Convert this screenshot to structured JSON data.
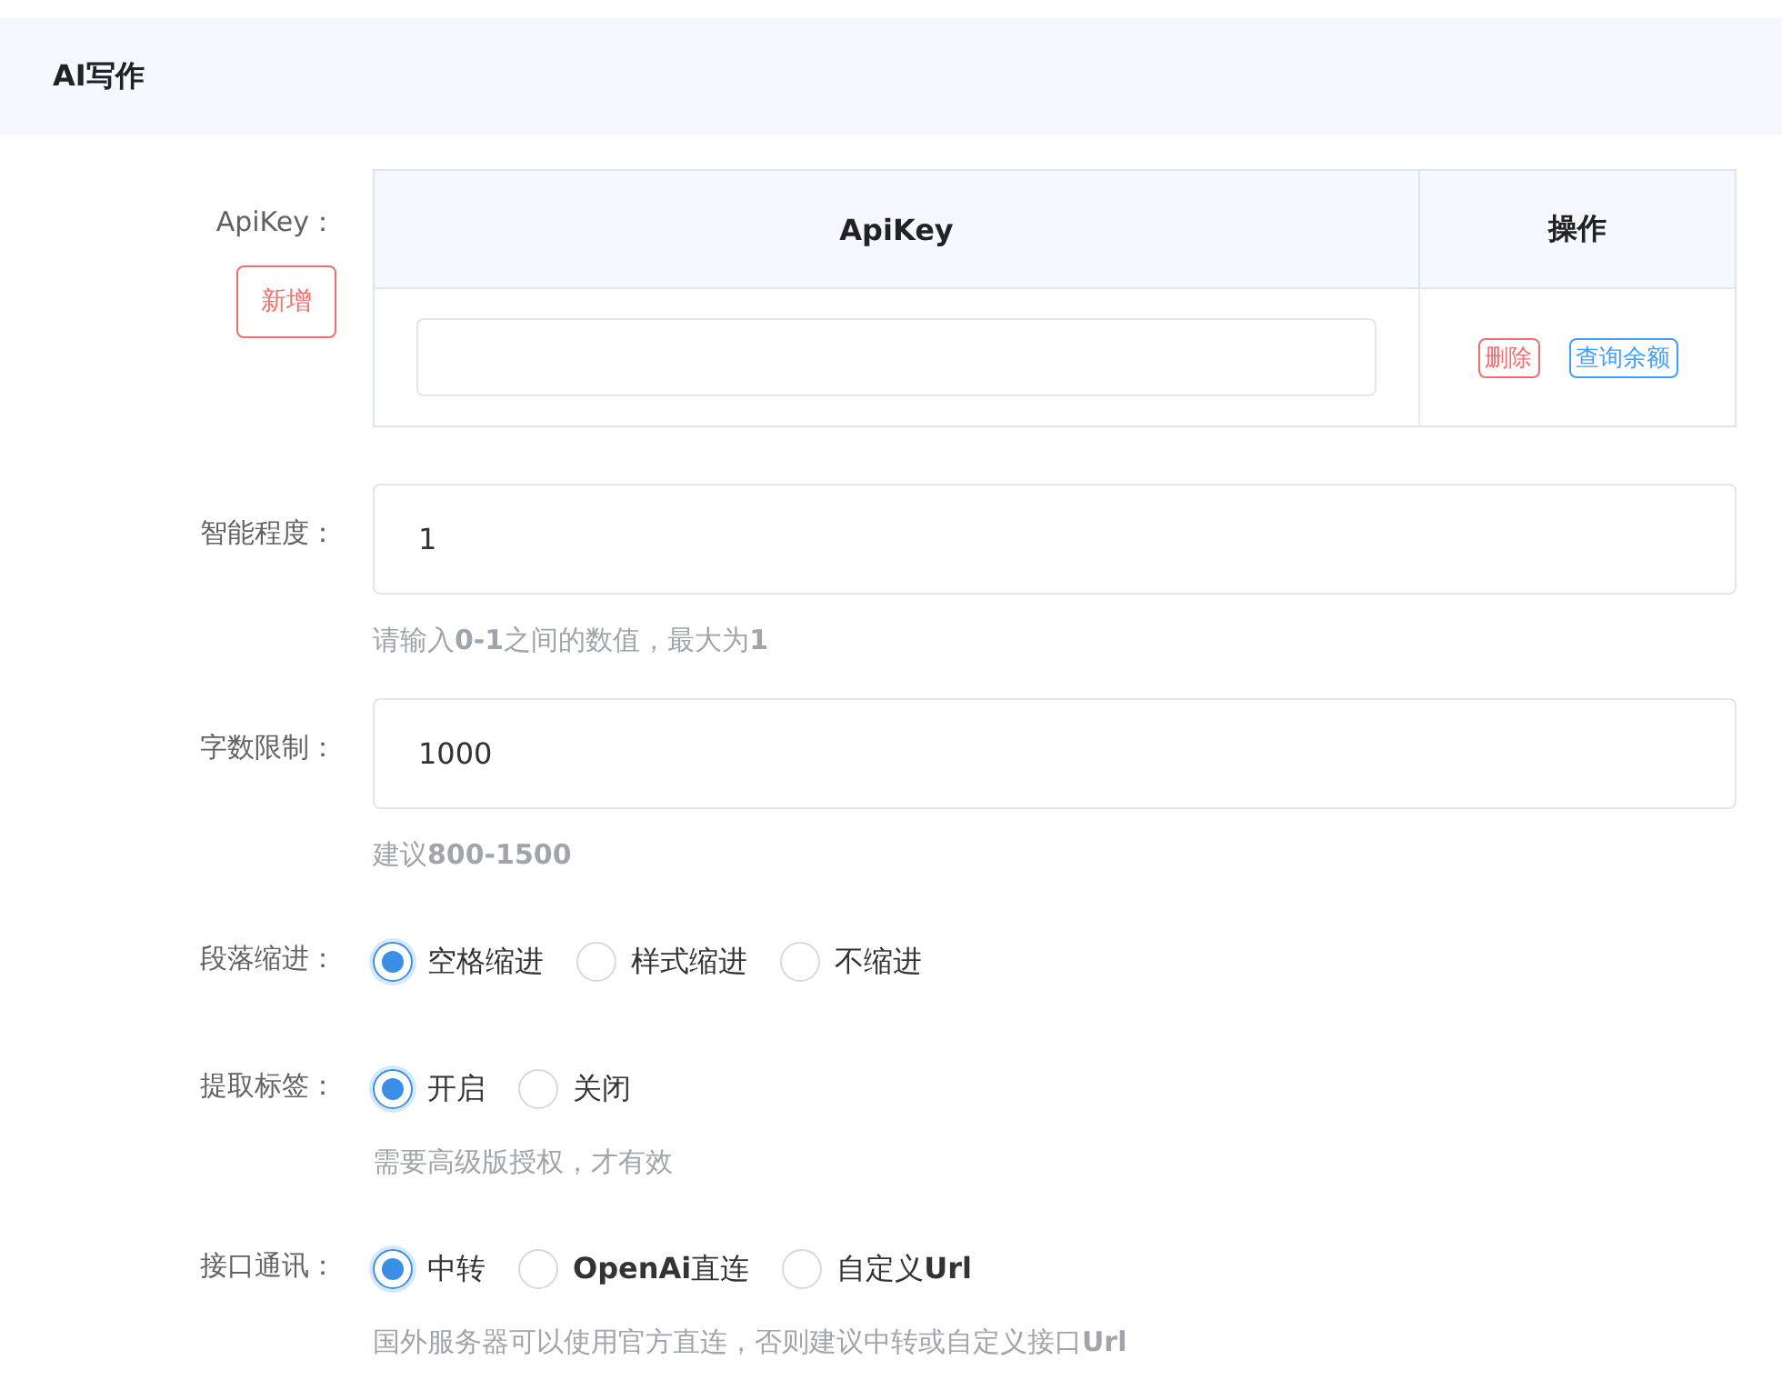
{
  "section": {
    "title": "AI写作"
  },
  "apikey": {
    "label": "ApiKey：",
    "add_button": "新增",
    "columns": [
      "ApiKey",
      "操作"
    ],
    "rows": [
      {
        "actions": [
          {
            "kind": "danger",
            "label": "删除"
          },
          {
            "kind": "primary",
            "label": "查询余额"
          }
        ]
      }
    ]
  },
  "fields": [
    {
      "kind": "input",
      "label": "智能程度：",
      "value": "1",
      "hint": "请输入**0-1**之间的数值，最大为**1**"
    },
    {
      "kind": "input",
      "label": "字数限制：",
      "value": "1000",
      "hint": "建议**800-1500**"
    },
    {
      "kind": "radio",
      "label": "段落缩进：",
      "options": [
        {
          "label": "空格缩进",
          "selected": true
        },
        {
          "label": "样式缩进",
          "selected": false
        },
        {
          "label": "不缩进",
          "selected": false
        }
      ]
    },
    {
      "kind": "radio",
      "label": "提取标签：",
      "options": [
        {
          "label": "开启",
          "selected": true
        },
        {
          "label": "关闭",
          "selected": false
        }
      ],
      "hint": "需要高级版授权，才有效"
    },
    {
      "kind": "radio",
      "label": "接口通讯：",
      "options": [
        {
          "label": "中转",
          "selected": true
        },
        {
          "label": "**OpenAi**直连",
          "selected": false
        },
        {
          "label": "自定义**Url**",
          "selected": false
        }
      ],
      "hint": "国外服务器可以使用官方直连，否则建议中转或自定义接口**Url**"
    }
  ]
}
